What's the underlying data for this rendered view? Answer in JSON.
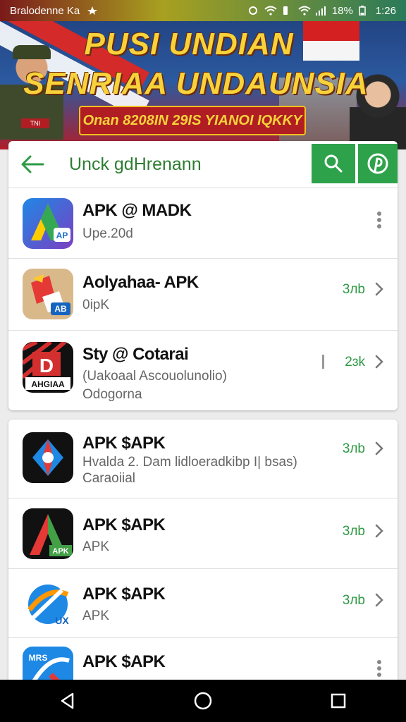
{
  "status_bar": {
    "carrier": "Bralodenne Ka",
    "battery": "18%",
    "time": "1:26"
  },
  "banner": {
    "title_line1": "PUSI UNDIAN",
    "title_line2": "SENRIAA UNDAUNSIA",
    "subtitle": "Onan 8208IN 29IS YIANOI IQKKY",
    "soldier_badge": "TNI"
  },
  "search": {
    "query": "Unck gdHrenann"
  },
  "card1": {
    "rows": [
      {
        "title": "APK @ MADK",
        "sub": "Upe.20d",
        "sub2": "",
        "size": "",
        "icon_label": "AP"
      },
      {
        "title": "Aolyahaa- APK",
        "sub": "0ipK",
        "sub2": "",
        "size": "3лb",
        "icon_label": "AB"
      },
      {
        "title": "Sty @ Cotarai",
        "sub": "(Uakoaal Ascouolunolio)",
        "sub2": "Odogorna",
        "size": "2ɜk",
        "icon_label": "AHGIAA"
      }
    ]
  },
  "card2": {
    "rows": [
      {
        "title": "APK $APK",
        "sub": "Hvalda 2. Dam lidloeradkibp I| bsas)",
        "sub2": "Caraoiial",
        "size": "3лb"
      },
      {
        "title": "APK $APK",
        "sub": "APK",
        "sub2": "",
        "size": "3лb",
        "icon_label": "APK"
      },
      {
        "title": "APK $APK",
        "sub": "APK",
        "sub2": "",
        "size": "3лb",
        "icon_label": "UX"
      },
      {
        "title": "APK $APK",
        "sub": "",
        "sub2": "",
        "size": "",
        "icon_label": "MRS"
      }
    ]
  },
  "colors": {
    "accent_green": "#2ea24a",
    "text_green": "#2e7d32"
  }
}
